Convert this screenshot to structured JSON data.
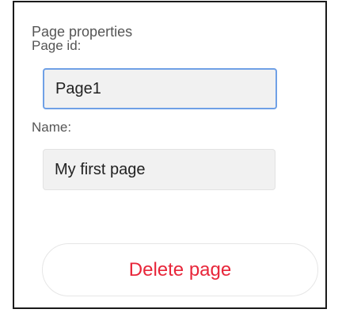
{
  "panel": {
    "title": "Page properties",
    "page_id": {
      "label": "Page id:",
      "value": "Page1"
    },
    "name": {
      "label": "Name:",
      "value": "My first page"
    },
    "delete_label": "Delete page"
  },
  "colors": {
    "delete_text": "#e8263a",
    "focus_border": "#6fa0e6",
    "input_background": "#f1f1f1",
    "label_text": "#555555"
  }
}
